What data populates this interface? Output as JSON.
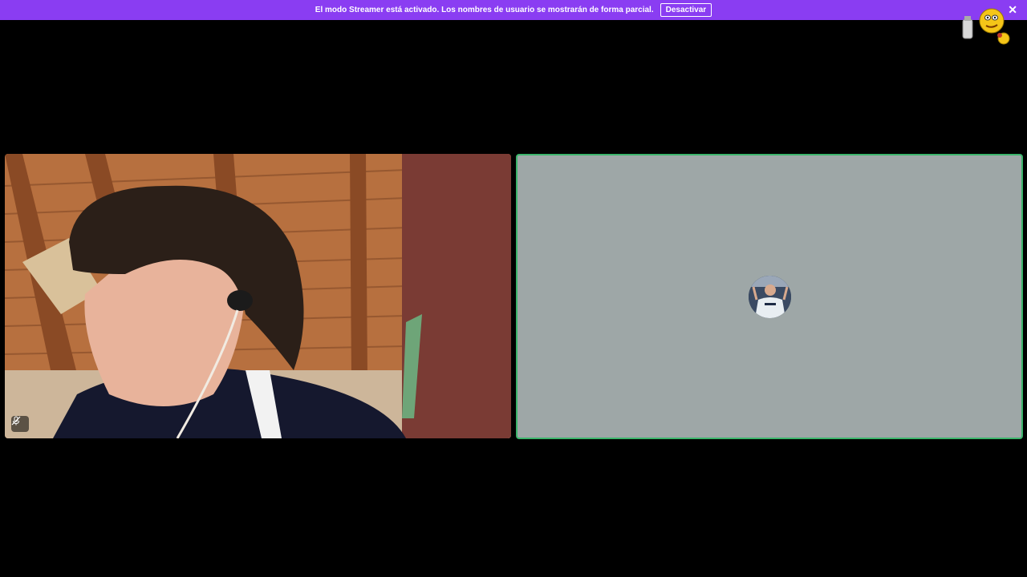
{
  "banner": {
    "message": "El modo Streamer está activado. Los nombres de usuario se mostrarán de forma parcial.",
    "deactivate_label": "Desactivar",
    "close_glyph": "✕",
    "color": "#8a3df2"
  },
  "tiles": {
    "camera": {
      "icon": "mic-muted-icon"
    },
    "avatar_tile": {
      "background": "#9ea7a7",
      "speaking_border": "#3bb46b"
    }
  }
}
